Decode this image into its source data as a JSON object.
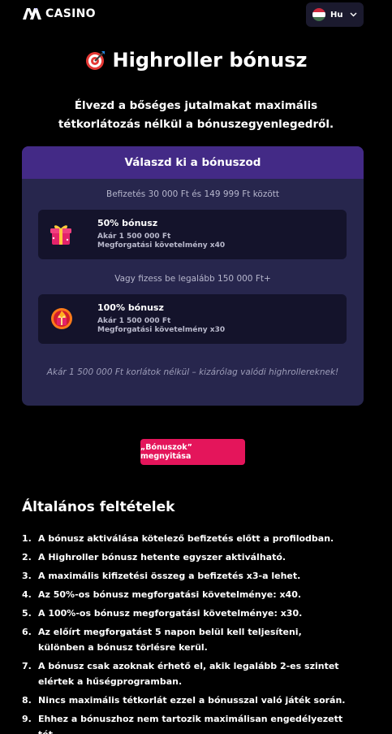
{
  "header": {
    "logo_text": "CASINO",
    "language_code": "Hu"
  },
  "page": {
    "title": "Highroller bónusz",
    "subtitle": "Élvezd a bőséges jutalmakat maximális tétkorlátozás nélkül a bónuszegyenlegedről."
  },
  "bonus_card": {
    "heading": "Válaszd ki a bónuszod",
    "range_note_1": "Befizetés 30 000 Ft és 149 999 Ft között",
    "range_note_2": "Vagy fizess be legalább 150 000 Ft+",
    "offers": [
      {
        "title": "50% bónusz",
        "amount": "Akár 1 500 000 Ft",
        "wager": "Megforgatási követelmény x40",
        "icon": "gift-box-icon"
      },
      {
        "title": "100% bónusz",
        "amount": "Akár 1 500 000 Ft",
        "wager": "Megforgatási követelmény x30",
        "icon": "fire-gift-icon"
      }
    ],
    "footer_note": "Akár 1 500 000 Ft korlátok nélkül – kizárólag valódi highrollereknek!"
  },
  "cta": {
    "label": "„Bónuszok” megnyitása"
  },
  "terms": {
    "title": "Általános feltételek",
    "items": [
      {
        "num": "1.",
        "text": "A bónusz aktiválása kötelező befizetés előtt a profilodban."
      },
      {
        "num": "2.",
        "text": "A Highroller bónusz hetente egyszer aktiválható."
      },
      {
        "num": "3.",
        "text": "A maximális kifizetési összeg a befizetés x3-a lehet."
      },
      {
        "num": "4.",
        "text": "Az 50%-os bónusz megforgatási követelménye: x40."
      },
      {
        "num": "5.",
        "text": "A 100%-os bónusz megforgatási követelménye: x30."
      },
      {
        "num": "6.",
        "text": "Az előírt megforgatást 5 napon belül kell teljesíteni, különben a bónusz törlésre kerül."
      },
      {
        "num": "7.",
        "text": "A bónusz csak azoknak érhető el, akik legalább 2-es szintet elértek a hűségprogramban."
      },
      {
        "num": "8.",
        "text": "Nincs maximális tétkorlát ezzel a bónusszal való játék során."
      },
      {
        "num": "9.",
        "text": "Ehhez a bónuszhoz nem tartozik maximálisan engedélyezett tét."
      }
    ]
  },
  "colors": {
    "background": "#000000",
    "card": "#27264d",
    "card_header": "#432a86",
    "offer_bg": "#14132b",
    "cta": "#e4155b"
  }
}
